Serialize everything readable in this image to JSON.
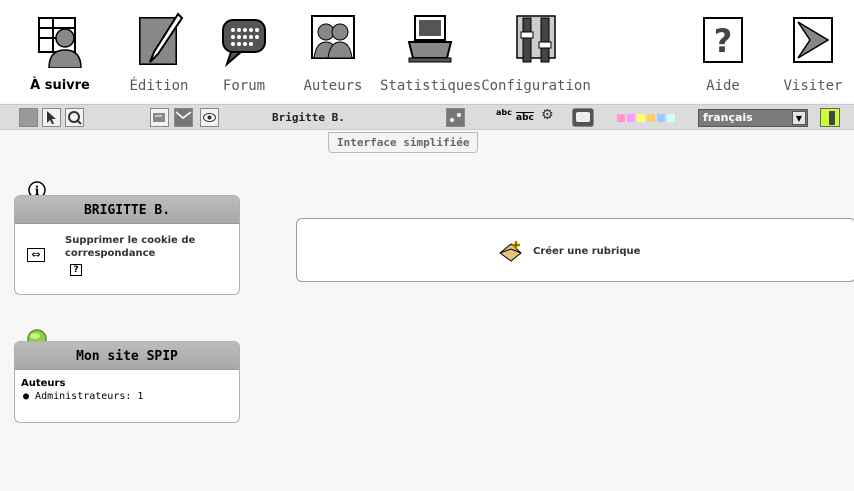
{
  "nav": {
    "items": [
      {
        "label": "À suivre"
      },
      {
        "label": "Édition"
      },
      {
        "label": "Forum"
      },
      {
        "label": "Auteurs"
      },
      {
        "label": "Statistiques"
      },
      {
        "label": "Configuration"
      },
      {
        "label": "Aide"
      },
      {
        "label": "Visiter"
      }
    ]
  },
  "toolbar": {
    "username": "Brigitte B.",
    "spellcheck_label": "abc",
    "spellcheck_alt": "abc",
    "language": "français",
    "tooltip": "Interface simplifiée"
  },
  "user_box": {
    "title": "BRIGITTE B.",
    "action_label": "Supprimer le cookie de correspondance",
    "help_glyph": "?"
  },
  "site_box": {
    "title": "Mon site SPIP",
    "section_label": "Auteurs",
    "list": [
      "Administrateurs: 1"
    ]
  },
  "main": {
    "create_label": "Créer une rubrique"
  },
  "colors": {
    "toolbar_bg": "#dcdcdc",
    "box_header": "#b4b4b4",
    "accent_green": "#8bd24a",
    "swatch_pink": "#ff99cc",
    "swatch_yellow": "#ffff66",
    "swatch_blue": "#99ccff"
  }
}
